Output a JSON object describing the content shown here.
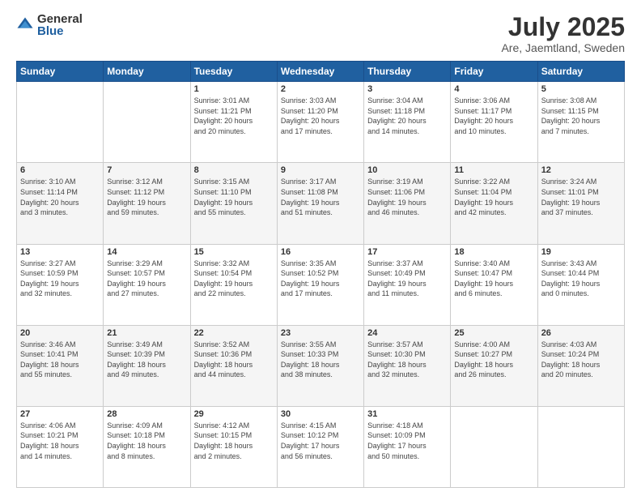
{
  "logo": {
    "general": "General",
    "blue": "Blue"
  },
  "title": {
    "month_year": "July 2025",
    "location": "Are, Jaemtland, Sweden"
  },
  "weekdays": [
    "Sunday",
    "Monday",
    "Tuesday",
    "Wednesday",
    "Thursday",
    "Friday",
    "Saturday"
  ],
  "weeks": [
    [
      {
        "day": "",
        "info": ""
      },
      {
        "day": "",
        "info": ""
      },
      {
        "day": "1",
        "info": "Sunrise: 3:01 AM\nSunset: 11:21 PM\nDaylight: 20 hours\nand 20 minutes."
      },
      {
        "day": "2",
        "info": "Sunrise: 3:03 AM\nSunset: 11:20 PM\nDaylight: 20 hours\nand 17 minutes."
      },
      {
        "day": "3",
        "info": "Sunrise: 3:04 AM\nSunset: 11:18 PM\nDaylight: 20 hours\nand 14 minutes."
      },
      {
        "day": "4",
        "info": "Sunrise: 3:06 AM\nSunset: 11:17 PM\nDaylight: 20 hours\nand 10 minutes."
      },
      {
        "day": "5",
        "info": "Sunrise: 3:08 AM\nSunset: 11:15 PM\nDaylight: 20 hours\nand 7 minutes."
      }
    ],
    [
      {
        "day": "6",
        "info": "Sunrise: 3:10 AM\nSunset: 11:14 PM\nDaylight: 20 hours\nand 3 minutes."
      },
      {
        "day": "7",
        "info": "Sunrise: 3:12 AM\nSunset: 11:12 PM\nDaylight: 19 hours\nand 59 minutes."
      },
      {
        "day": "8",
        "info": "Sunrise: 3:15 AM\nSunset: 11:10 PM\nDaylight: 19 hours\nand 55 minutes."
      },
      {
        "day": "9",
        "info": "Sunrise: 3:17 AM\nSunset: 11:08 PM\nDaylight: 19 hours\nand 51 minutes."
      },
      {
        "day": "10",
        "info": "Sunrise: 3:19 AM\nSunset: 11:06 PM\nDaylight: 19 hours\nand 46 minutes."
      },
      {
        "day": "11",
        "info": "Sunrise: 3:22 AM\nSunset: 11:04 PM\nDaylight: 19 hours\nand 42 minutes."
      },
      {
        "day": "12",
        "info": "Sunrise: 3:24 AM\nSunset: 11:01 PM\nDaylight: 19 hours\nand 37 minutes."
      }
    ],
    [
      {
        "day": "13",
        "info": "Sunrise: 3:27 AM\nSunset: 10:59 PM\nDaylight: 19 hours\nand 32 minutes."
      },
      {
        "day": "14",
        "info": "Sunrise: 3:29 AM\nSunset: 10:57 PM\nDaylight: 19 hours\nand 27 minutes."
      },
      {
        "day": "15",
        "info": "Sunrise: 3:32 AM\nSunset: 10:54 PM\nDaylight: 19 hours\nand 22 minutes."
      },
      {
        "day": "16",
        "info": "Sunrise: 3:35 AM\nSunset: 10:52 PM\nDaylight: 19 hours\nand 17 minutes."
      },
      {
        "day": "17",
        "info": "Sunrise: 3:37 AM\nSunset: 10:49 PM\nDaylight: 19 hours\nand 11 minutes."
      },
      {
        "day": "18",
        "info": "Sunrise: 3:40 AM\nSunset: 10:47 PM\nDaylight: 19 hours\nand 6 minutes."
      },
      {
        "day": "19",
        "info": "Sunrise: 3:43 AM\nSunset: 10:44 PM\nDaylight: 19 hours\nand 0 minutes."
      }
    ],
    [
      {
        "day": "20",
        "info": "Sunrise: 3:46 AM\nSunset: 10:41 PM\nDaylight: 18 hours\nand 55 minutes."
      },
      {
        "day": "21",
        "info": "Sunrise: 3:49 AM\nSunset: 10:39 PM\nDaylight: 18 hours\nand 49 minutes."
      },
      {
        "day": "22",
        "info": "Sunrise: 3:52 AM\nSunset: 10:36 PM\nDaylight: 18 hours\nand 44 minutes."
      },
      {
        "day": "23",
        "info": "Sunrise: 3:55 AM\nSunset: 10:33 PM\nDaylight: 18 hours\nand 38 minutes."
      },
      {
        "day": "24",
        "info": "Sunrise: 3:57 AM\nSunset: 10:30 PM\nDaylight: 18 hours\nand 32 minutes."
      },
      {
        "day": "25",
        "info": "Sunrise: 4:00 AM\nSunset: 10:27 PM\nDaylight: 18 hours\nand 26 minutes."
      },
      {
        "day": "26",
        "info": "Sunrise: 4:03 AM\nSunset: 10:24 PM\nDaylight: 18 hours\nand 20 minutes."
      }
    ],
    [
      {
        "day": "27",
        "info": "Sunrise: 4:06 AM\nSunset: 10:21 PM\nDaylight: 18 hours\nand 14 minutes."
      },
      {
        "day": "28",
        "info": "Sunrise: 4:09 AM\nSunset: 10:18 PM\nDaylight: 18 hours\nand 8 minutes."
      },
      {
        "day": "29",
        "info": "Sunrise: 4:12 AM\nSunset: 10:15 PM\nDaylight: 18 hours\nand 2 minutes."
      },
      {
        "day": "30",
        "info": "Sunrise: 4:15 AM\nSunset: 10:12 PM\nDaylight: 17 hours\nand 56 minutes."
      },
      {
        "day": "31",
        "info": "Sunrise: 4:18 AM\nSunset: 10:09 PM\nDaylight: 17 hours\nand 50 minutes."
      },
      {
        "day": "",
        "info": ""
      },
      {
        "day": "",
        "info": ""
      }
    ]
  ]
}
